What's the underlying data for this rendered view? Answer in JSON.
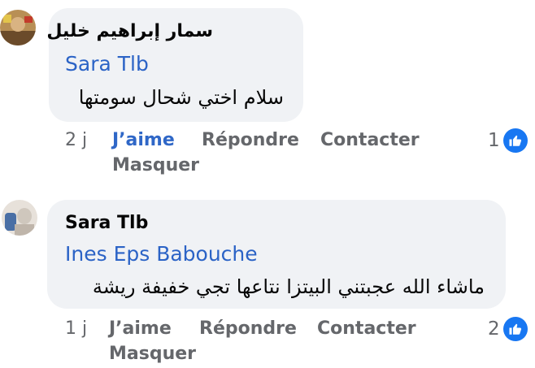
{
  "comments": [
    {
      "author": "سمار إبراهيم خليل",
      "mention": "Sara Tlb",
      "text": "سلام اختي شحال سومتها",
      "time": "2 j",
      "like_label": "J’aime",
      "reply_label": "Répondre",
      "contact_label": "Contacter",
      "hide_label": "Masquer",
      "reaction_count": "1",
      "liked": true
    },
    {
      "author": "Sara Tlb",
      "mention": "Ines Eps Babouche",
      "text": "ماشاء الله عجبتني البيتزا نتاعها تجي خفيفة ريشة",
      "time": "1 j",
      "like_label": "J’aime",
      "reply_label": "Répondre",
      "contact_label": "Contacter",
      "hide_label": "Masquer",
      "reaction_count": "2",
      "liked": false
    }
  ],
  "colors": {
    "bubble": "#f0f2f5",
    "mention": "#2b63c6",
    "liked": "#2f67c7",
    "meta": "#65676b",
    "like_badge": "#1877f2"
  },
  "icons": [
    "like-thumb-icon"
  ]
}
